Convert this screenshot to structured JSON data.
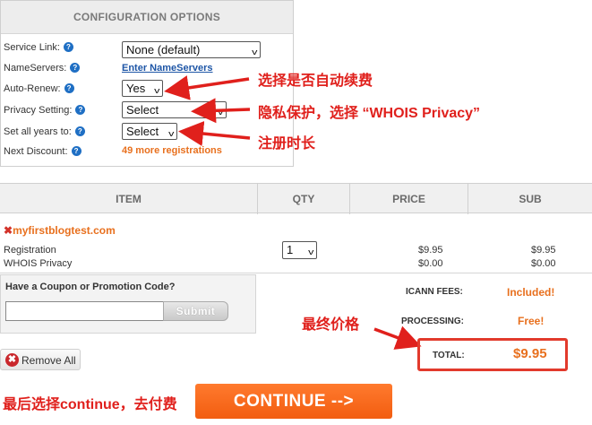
{
  "config": {
    "header": "CONFIGURATION OPTIONS",
    "rows": [
      {
        "label": "Service Link:",
        "value": "None (default)"
      },
      {
        "label": "NameServers:",
        "value": "Enter NameServers"
      },
      {
        "label": "Auto-Renew:",
        "value": "Yes"
      },
      {
        "label": "Privacy Setting:",
        "value": "Select"
      },
      {
        "label": "Set all years to:",
        "value": "Select"
      },
      {
        "label": "Next Discount:",
        "value": "49 more registrations"
      }
    ],
    "help_glyph": "?"
  },
  "annotations": {
    "auto_renew": "选择是否自动续费",
    "privacy": "隐私保护，选择 “WHOIS Privacy”",
    "years": "注册时长",
    "final_price": "最终价格",
    "continue_hint": "最后选择continue，去付费"
  },
  "table": {
    "headers": [
      "ITEM",
      "QTY",
      "PRICE",
      "SUB"
    ],
    "domain": "myfirstblogtest.com",
    "remove_glyph": "✖",
    "lines": [
      {
        "item": "Registration",
        "price": "$9.95",
        "sub": "$9.95"
      },
      {
        "item": "WHOIS Privacy",
        "price": "$0.00",
        "sub": "$0.00"
      }
    ],
    "qty": "1"
  },
  "coupon": {
    "title": "Have a Coupon or Promotion Code?",
    "value": "",
    "submit": "Submit"
  },
  "fees": {
    "icann_label": "ICANN FEES:",
    "icann_value": "Included!",
    "processing_label": "PROCESSING:",
    "processing_value": "Free!",
    "total_label": "TOTAL:",
    "total_value": "$9.95"
  },
  "actions": {
    "remove_all": "Remove All",
    "continue": "CONTINUE -->"
  },
  "colors": {
    "accent_orange": "#f25d10",
    "annotation_red": "#e0201c",
    "link_blue": "#1d55a6"
  }
}
